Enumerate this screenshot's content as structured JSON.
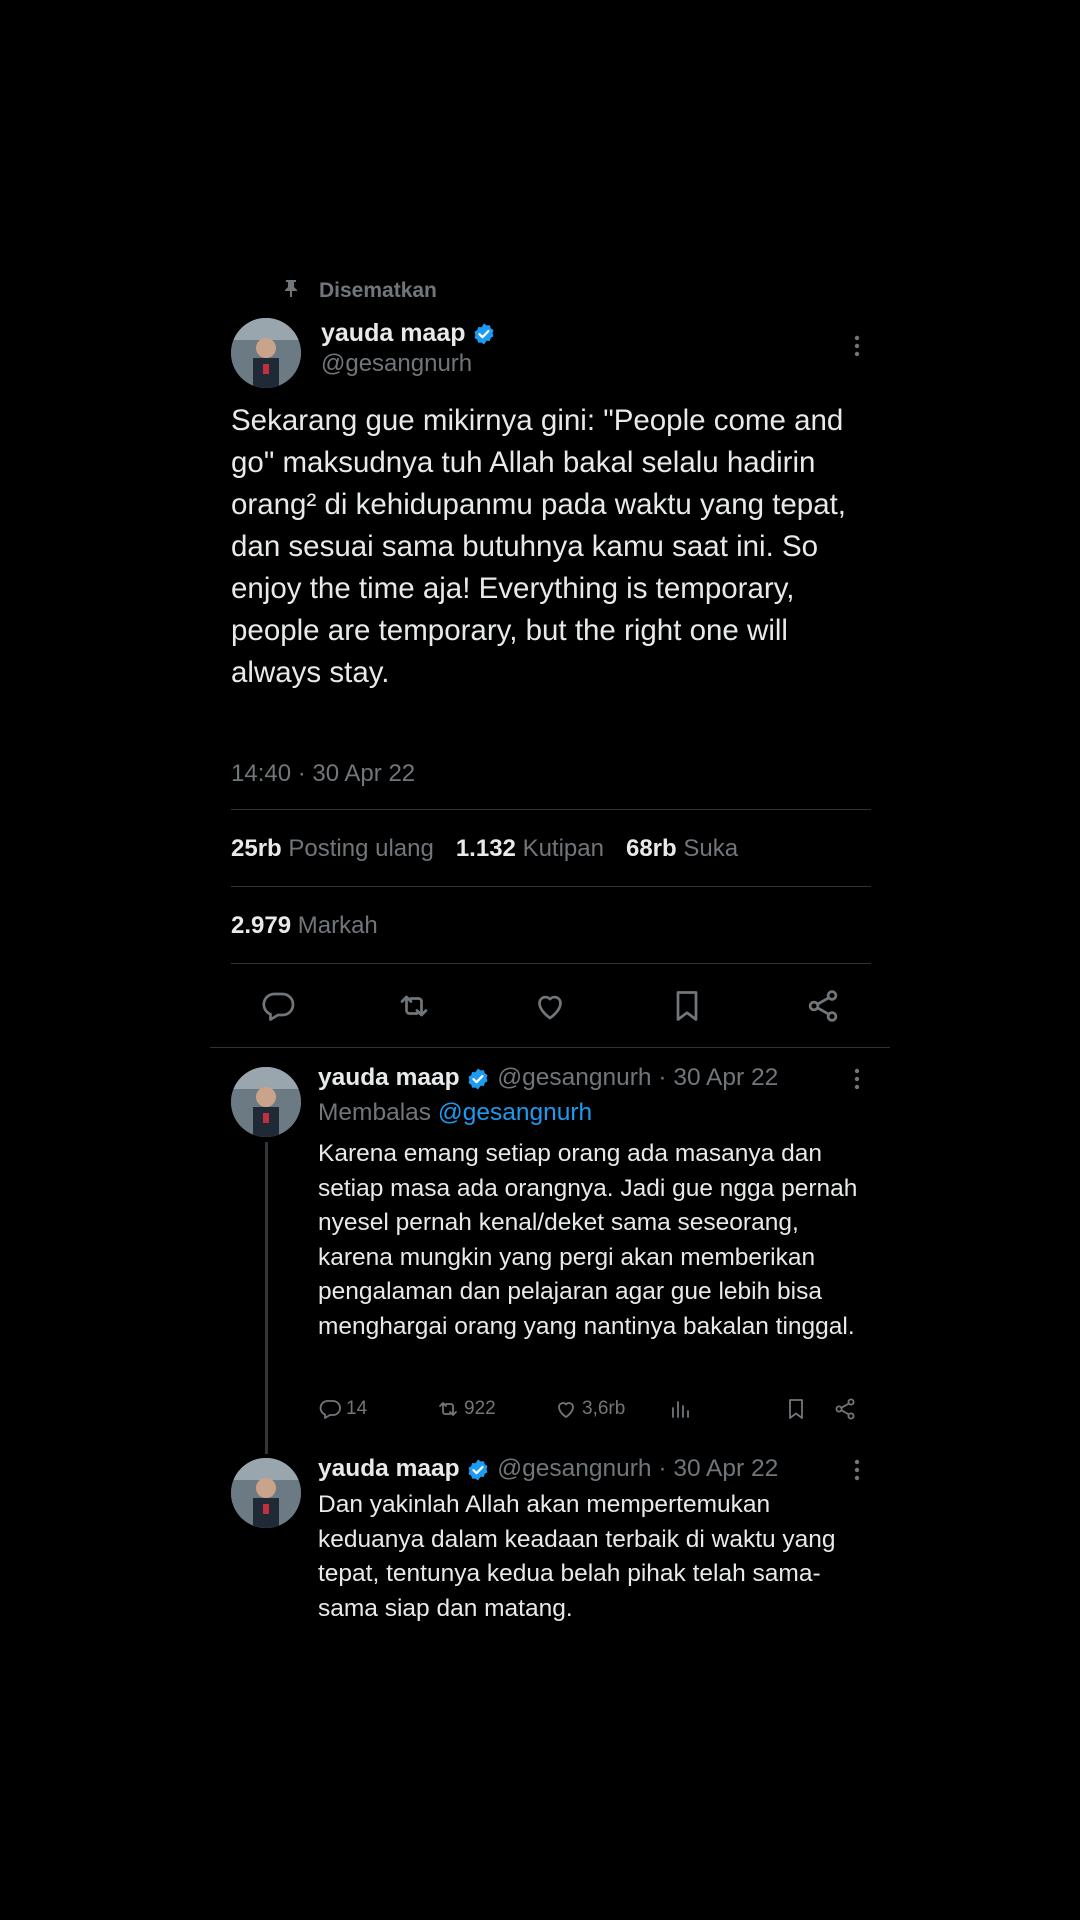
{
  "pinned": {
    "label": "Disematkan"
  },
  "main_tweet": {
    "name": "yauda maap",
    "handle": "@gesangnurh",
    "text": "Sekarang gue mikirnya gini: \"People come and go\" maksudnya tuh Allah bakal selalu hadirin orang² di kehidupanmu pada waktu yang tepat, dan sesuai sama butuhnya kamu saat ini. So enjoy the time aja! Everything is temporary, people are temporary, but the right one will always stay.",
    "timestamp": "14:40 · 30 Apr 22",
    "stats": {
      "reposts_value": "25rb",
      "reposts_label": "Posting ulang",
      "quotes_value": "1.132",
      "quotes_label": "Kutipan",
      "likes_value": "68rb",
      "likes_label": "Suka",
      "bookmarks_value": "2.979",
      "bookmarks_label": "Markah"
    }
  },
  "replies": [
    {
      "name": "yauda maap",
      "handle": "@gesangnurh",
      "date": "· 30 Apr 22",
      "replying_label": "Membalas",
      "replying_handle": "@gesangnurh",
      "text": "Karena emang setiap orang ada masanya dan setiap masa ada orangnya. Jadi gue ngga pernah nyesel pernah kenal/deket sama seseorang, karena mungkin yang pergi akan memberikan pengalaman dan pelajaran agar gue lebih bisa menghargai orang yang nantinya bakalan tinggal.",
      "comments": "14",
      "reposts": "922",
      "likes": "3,6rb"
    },
    {
      "name": "yauda maap",
      "handle": "@gesangnurh",
      "date": "· 30 Apr 22",
      "text": "Dan yakinlah Allah akan mempertemukan keduanya dalam keadaan terbaik di waktu yang tepat, tentunya kedua belah pihak telah sama-sama siap dan matang."
    }
  ],
  "colors": {
    "background": "#000000",
    "text": "#e7e9ea",
    "muted": "#71767b",
    "accent": "#1d9bf0",
    "divider": "#2f3336"
  },
  "icons": [
    "pin-icon",
    "verified-icon",
    "more-icon",
    "comment-icon",
    "repost-icon",
    "like-icon",
    "bookmark-icon",
    "share-icon",
    "views-icon"
  ]
}
